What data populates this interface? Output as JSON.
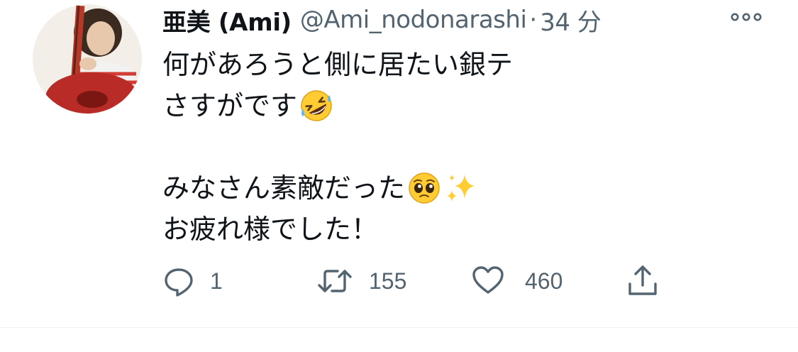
{
  "tweet": {
    "display_name": "亜美 (Ami)",
    "handle": "@Ami_nodonarashi",
    "separator": "·",
    "time": "34 分",
    "lines": [
      "何があろうと側に居たい銀テ",
      "さすがです",
      "",
      "みなさん素敵だった",
      "お疲れ様でした！"
    ],
    "emojis": {
      "line2": "rolling-on-floor-laughing-emoji",
      "line4a": "pleading-face-emoji",
      "line4b": "sparkles-emoji"
    }
  },
  "actions": {
    "reply_count": "1",
    "retweet_count": "155",
    "like_count": "460"
  },
  "icons": {
    "reply": "reply-icon",
    "retweet": "retweet-icon",
    "like": "heart-icon",
    "share": "share-icon",
    "more": "more-icon"
  },
  "colors": {
    "text": "#0f1419",
    "secondary": "#536471",
    "divider": "#eff3f4"
  }
}
